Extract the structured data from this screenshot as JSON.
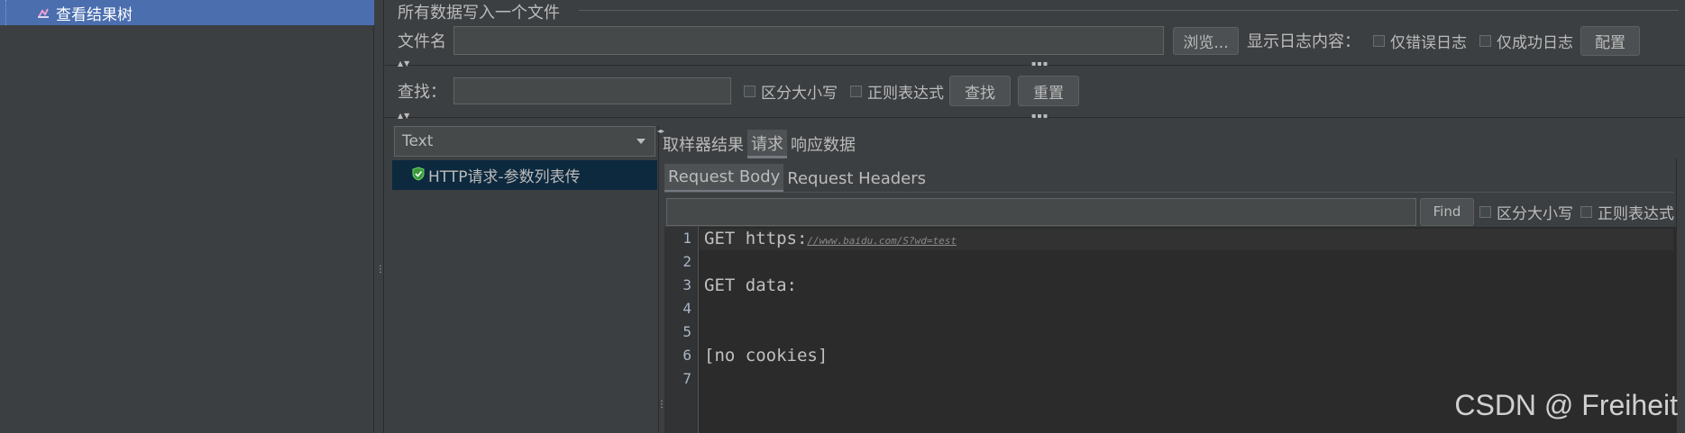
{
  "tree": {
    "selected_item": "查看结果树"
  },
  "file_section": {
    "title": "所有数据写入一个文件",
    "filename_label": "文件名",
    "filename_value": "",
    "browse_label": "浏览...",
    "log_label": "显示日志内容：",
    "errors_only_label": "仅错误日志",
    "success_only_label": "仅成功日志",
    "config_label": "配置"
  },
  "search": {
    "label": "查找：",
    "value": "",
    "case_label": "区分大小写",
    "regex_label": "正则表达式",
    "find_label": "查找",
    "reset_label": "重置"
  },
  "renderer": {
    "selected": "Text"
  },
  "results": {
    "items": [
      "HTTP请求-参数列表传"
    ]
  },
  "tabs": [
    "取样器结果",
    "请求",
    "响应数据"
  ],
  "active_tab": "请求",
  "subtabs": [
    "Request Body",
    "Request Headers"
  ],
  "active_subtab": "Request Body",
  "editor_find": {
    "value": "",
    "find_label": "Find",
    "case_label": "区分大小写",
    "regex_label": "正则表达式"
  },
  "editor": {
    "line_numbers": [
      "1",
      "2",
      "3",
      "4",
      "5",
      "6",
      "7"
    ],
    "line1_prefix": "GET https:",
    "line1_link": "//www.baidu.com/S?wd=test",
    "line3": "GET data:",
    "line6": "[no cookies]"
  },
  "watermark": "CSDN @ Freiheit"
}
